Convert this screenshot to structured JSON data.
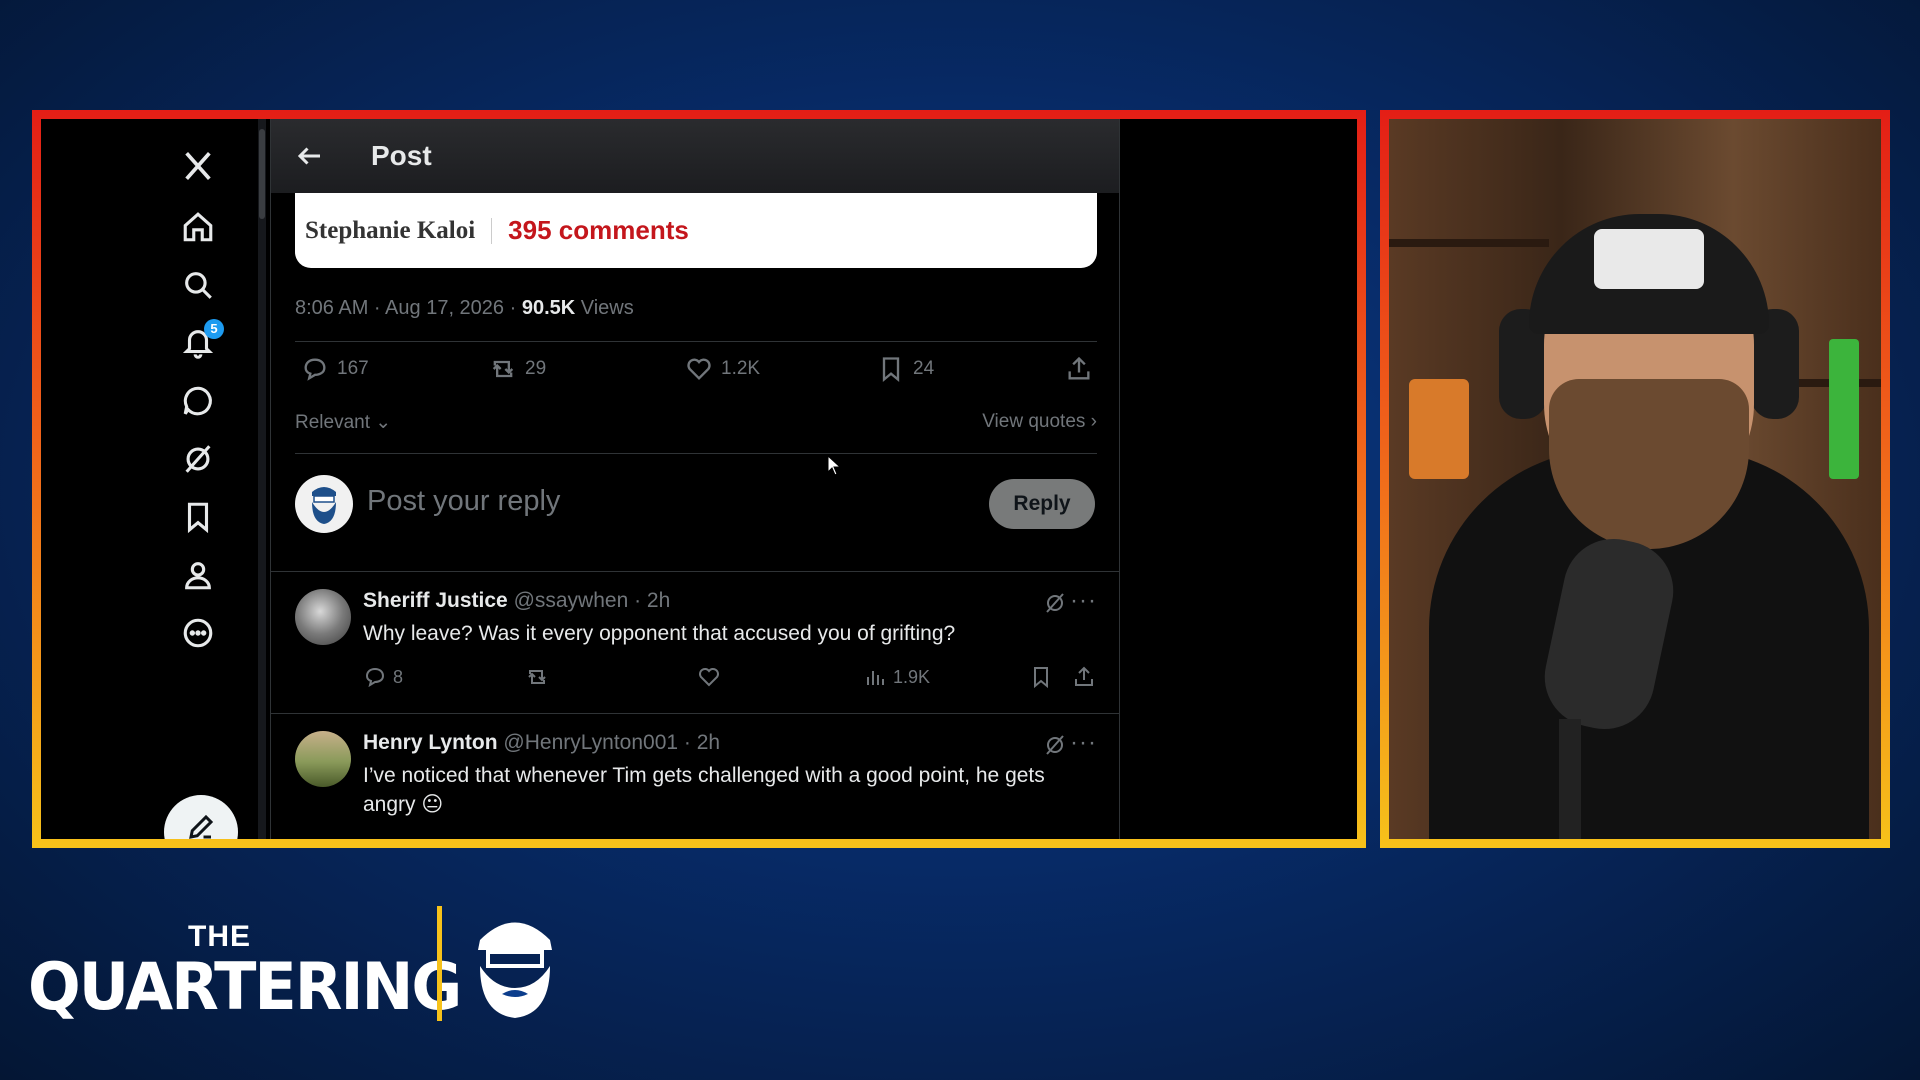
{
  "nav": {
    "notifications_badge": "5",
    "icons": [
      "x-logo-icon",
      "home-icon",
      "search-icon",
      "bell-icon",
      "messages-icon",
      "grok-icon",
      "bookmark-icon",
      "profile-icon",
      "more-icon"
    ]
  },
  "header": {
    "title": "Post"
  },
  "card": {
    "author": "Stephanie Kaloi",
    "comments": "395 comments"
  },
  "meta": {
    "time": "8:06 AM · Aug 17, 2026 · ",
    "views_count": "90.5K",
    "views_label": " Views"
  },
  "actions": {
    "replies": "167",
    "reposts": "29",
    "likes": "1.2K",
    "bookmarks": "24"
  },
  "sort": {
    "label": "Relevant",
    "view_quotes": "View quotes"
  },
  "reply_box": {
    "placeholder": "Post your reply",
    "button": "Reply"
  },
  "replies": [
    {
      "name": "Sheriff Justice",
      "handle": "@ssaywhen · 2h",
      "text": "Why leave? Was it every opponent that accused you of grifting?",
      "replies": "8",
      "views": "1.9K"
    },
    {
      "name": "Henry Lynton",
      "handle": "@HenryLynton001 · 2h",
      "text": "I’ve noticed that whenever Tim gets challenged with a good point, he gets angry 😐"
    }
  ],
  "brand": {
    "the": "THE",
    "name": "QUARTERING"
  },
  "colors": {
    "frame_top": "#e41e16",
    "frame_bottom": "#f7c21a",
    "link_red": "#c4161c",
    "badge": "#1d9bf0"
  }
}
